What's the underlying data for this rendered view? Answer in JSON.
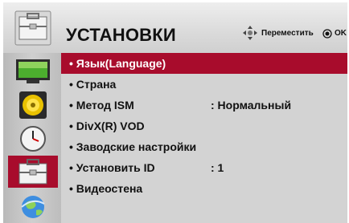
{
  "header": {
    "title": "УСТАНОВКИ",
    "nav_hint": "Переместить",
    "ok_hint": "OK",
    "icon": "toolbox-icon"
  },
  "sidebar": {
    "items": [
      {
        "icon": "monitor-icon",
        "selected": false
      },
      {
        "icon": "speaker-icon",
        "selected": false
      },
      {
        "icon": "clock-icon",
        "selected": false
      },
      {
        "icon": "toolbox-icon",
        "selected": true
      },
      {
        "icon": "globe-icon",
        "selected": false
      }
    ]
  },
  "menu": {
    "items": [
      {
        "label": "• Язык(Language)",
        "value": "",
        "selected": true
      },
      {
        "label": "• Страна",
        "value": "",
        "selected": false
      },
      {
        "label": "• Метод ISM",
        "value": ": Нормальный",
        "selected": false
      },
      {
        "label": "• DivX(R) VOD",
        "value": "",
        "selected": false
      },
      {
        "label": "• Заводские настройки",
        "value": "",
        "selected": false
      },
      {
        "label": "• Установить ID",
        "value": ": 1",
        "selected": false
      },
      {
        "label": "• Видеостена",
        "value": "",
        "selected": false
      }
    ]
  },
  "colors": {
    "accent": "#a80c2c",
    "menu_bg": "#d3d3d3",
    "sidebar_bg": "#c4c4c4",
    "header_bg": "#e2e2e2"
  }
}
